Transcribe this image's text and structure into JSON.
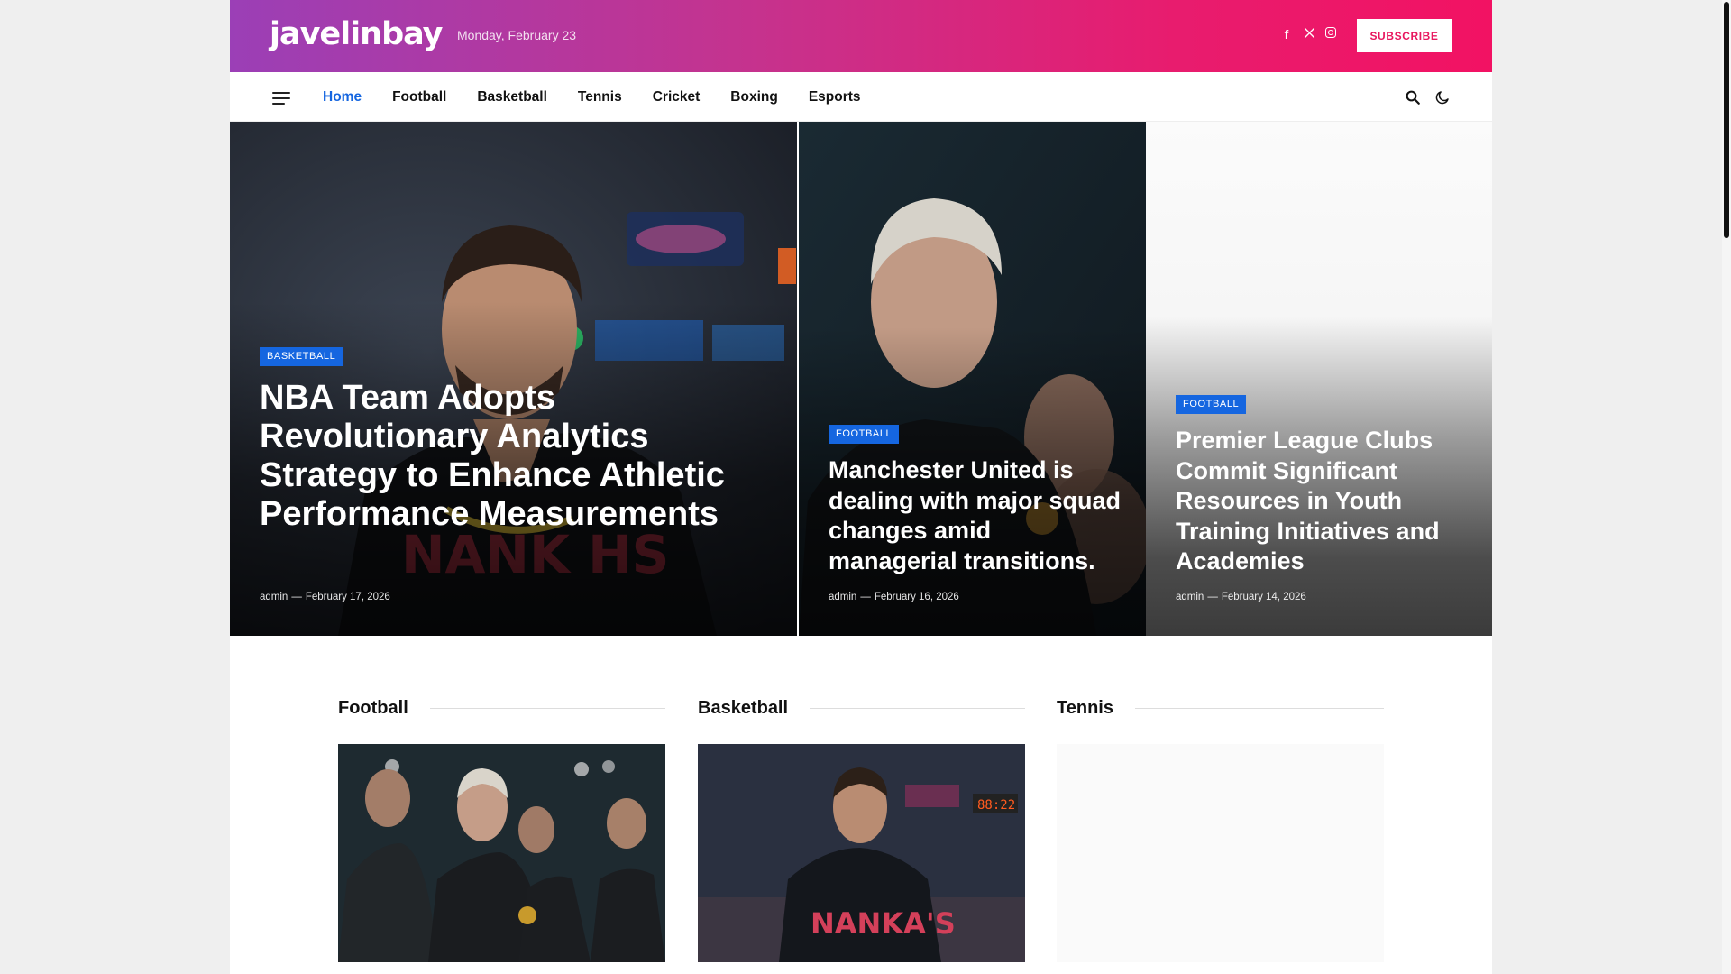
{
  "header": {
    "logo": "javelinbay",
    "date": "Monday, February 23",
    "subscribe_label": "SUBSCRIBE",
    "social_icons": [
      "facebook-icon",
      "x-icon",
      "instagram-icon"
    ]
  },
  "nav": {
    "items": [
      "Home",
      "Football",
      "Basketball",
      "Tennis",
      "Cricket",
      "Boxing",
      "Esports"
    ],
    "active": "Home"
  },
  "hero": [
    {
      "category": "BASKETBALL",
      "title": "NBA Team Adopts Revolutionary Analytics Strategy to Enhance Athletic Performance Measurements",
      "author": "admin",
      "date": "February 17, 2026"
    },
    {
      "category": "FOOTBALL",
      "title": "Manchester United is dealing with major squad changes amid managerial transitions.",
      "author": "admin",
      "date": "February 16, 2026"
    },
    {
      "category": "FOOTBALL",
      "title": "Premier League Clubs Commit Significant Resources in Youth Training Initiatives and Academies",
      "author": "admin",
      "date": "February 14, 2026"
    }
  ],
  "sections": [
    {
      "title": "Football"
    },
    {
      "title": "Basketball"
    },
    {
      "title": "Tennis"
    }
  ],
  "colors": {
    "accent": "#1566e0",
    "brand_gradient_start": "#9b3fb6",
    "brand_gradient_end": "#f21263",
    "subscribe_text": "#e8175f"
  }
}
